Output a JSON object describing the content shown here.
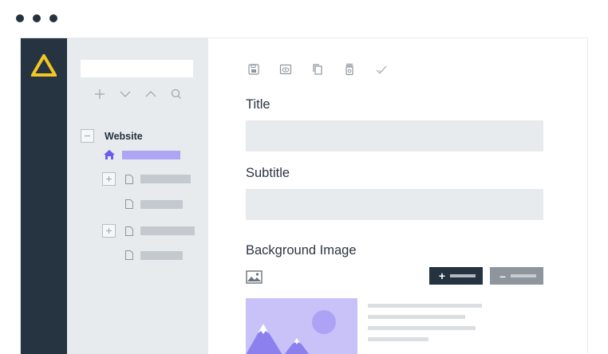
{
  "window_controls": [
    "dot",
    "dot",
    "dot"
  ],
  "brand": {
    "logo_icon": "triangle-logo-icon",
    "accent": "#f3c623"
  },
  "tree": {
    "search": {
      "value": "",
      "placeholder": ""
    },
    "tools": [
      "plus-icon",
      "chevron-down-icon",
      "chevron-up-icon",
      "search-icon"
    ],
    "root_label": "Website",
    "nodes": [
      {
        "icon": "home-icon",
        "state": "selected"
      },
      {
        "icon": "page-icon",
        "expander": "plus"
      },
      {
        "icon": "page-icon"
      },
      {
        "icon": "page-icon",
        "expander": "plus"
      },
      {
        "icon": "page-icon"
      }
    ]
  },
  "editor": {
    "toolbar": [
      "save-icon",
      "preview-icon",
      "copy-icon",
      "delete-icon",
      "publish-check-icon"
    ],
    "fields": {
      "title_label": "Title",
      "title_value": "",
      "subtitle_label": "Subtitle",
      "subtitle_value": "",
      "background_label": "Background Image"
    },
    "buttons": {
      "add_sign": "+",
      "remove_sign": "–"
    }
  },
  "colors": {
    "rail": "#253440",
    "tree_bg": "#e7ebee",
    "selection": "#aea6f4",
    "image_bg": "#c9c2f8",
    "image_accent": "#8c80ef"
  }
}
